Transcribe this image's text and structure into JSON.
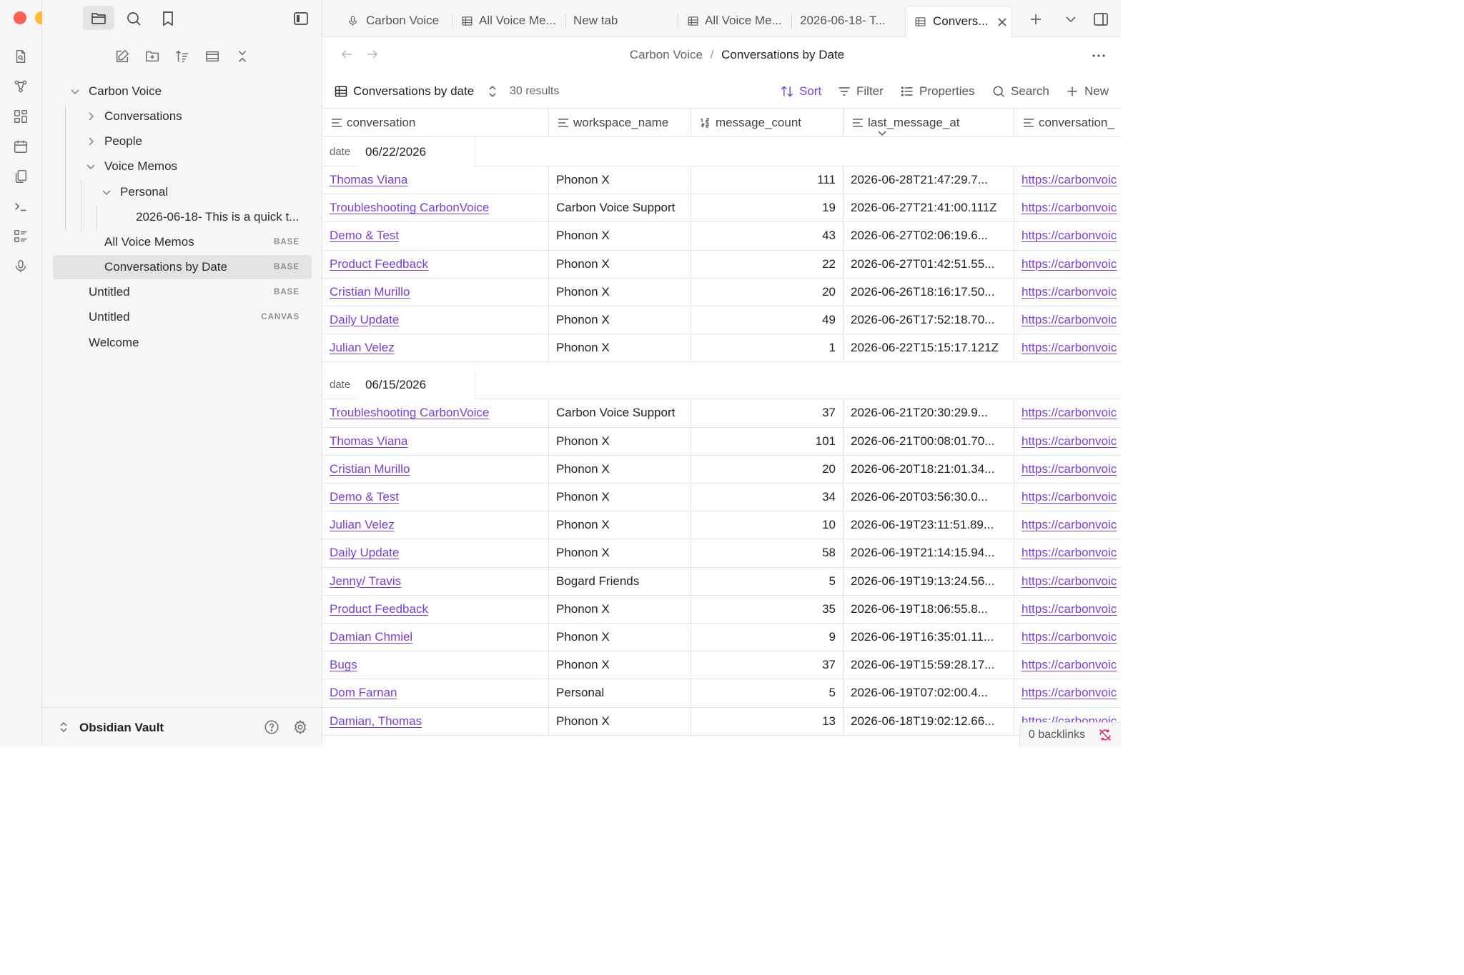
{
  "window": {
    "traffic_colors": [
      "#ff5f57",
      "#febc2e",
      "#28c840"
    ]
  },
  "ribbon": {
    "icons": [
      "quick-switcher-icon",
      "graph-view-icon",
      "canvas-icon",
      "daily-note-icon",
      "templates-icon",
      "command-palette-icon",
      "bases-icon",
      "voice-memo-icon"
    ]
  },
  "sidebar": {
    "tree": [
      {
        "label": "Carbon Voice",
        "level": 0,
        "chevron": "open",
        "badge": ""
      },
      {
        "label": "Conversations",
        "level": 1,
        "chevron": "closed",
        "badge": ""
      },
      {
        "label": "People",
        "level": 1,
        "chevron": "closed",
        "badge": ""
      },
      {
        "label": "Voice Memos",
        "level": 1,
        "chevron": "open",
        "badge": ""
      },
      {
        "label": "Personal",
        "level": 2,
        "chevron": "open",
        "badge": ""
      },
      {
        "label": "2026-06-18- This is a quick t...",
        "level": 3,
        "chevron": "",
        "badge": ""
      },
      {
        "label": "All Voice Memos",
        "level": 1,
        "chevron": "",
        "badge": "BASE"
      },
      {
        "label": "Conversations by Date",
        "level": 1,
        "chevron": "",
        "badge": "BASE",
        "selected": true
      },
      {
        "label": "Untitled",
        "level": 0,
        "chevron": "",
        "badge": "BASE"
      },
      {
        "label": "Untitled",
        "level": 0,
        "chevron": "",
        "badge": "CANVAS"
      },
      {
        "label": "Welcome",
        "level": 0,
        "chevron": "",
        "badge": ""
      }
    ],
    "vault_name": "Obsidian Vault"
  },
  "tabs": [
    {
      "label": "Carbon Voice",
      "icon": "microphone-icon"
    },
    {
      "label": "All Voice Me...",
      "icon": "table-icon"
    },
    {
      "label": "New tab",
      "icon": ""
    },
    {
      "label": "All Voice Me...",
      "icon": "table-icon"
    },
    {
      "label": "2026-06-18- T...",
      "icon": ""
    },
    {
      "label": "Convers...",
      "icon": "table-icon",
      "active": true
    }
  ],
  "breadcrumb": {
    "parent": "Carbon Voice",
    "separator": "/",
    "current": "Conversations by Date"
  },
  "toolbar": {
    "view_name": "Conversations by date",
    "results": "30 results",
    "sort": "Sort",
    "filter": "Filter",
    "properties": "Properties",
    "search": "Search",
    "new": "New",
    "accent": "#7b3fd6"
  },
  "table": {
    "columns": [
      {
        "label": "conversation",
        "icon": "text-icon"
      },
      {
        "label": "workspace_name",
        "icon": "text-icon"
      },
      {
        "label": "message_count",
        "icon": "number-icon"
      },
      {
        "label": "last_message_at",
        "icon": "text-icon",
        "sorted": true
      },
      {
        "label": "conversation_",
        "icon": "text-icon"
      }
    ],
    "groups": [
      {
        "label": "date",
        "value": "06/22/2026",
        "rows": [
          [
            "Thomas Viana",
            "Phonon X",
            "111",
            "2026-06-28T21:47:29.7...",
            "https://carbonvoic"
          ],
          [
            "Troubleshooting CarbonVoice",
            "Carbon Voice Support",
            "19",
            "2026-06-27T21:41:00.111Z",
            "https://carbonvoic"
          ],
          [
            "Demo & Test",
            "Phonon X",
            "43",
            "2026-06-27T02:06:19.6...",
            "https://carbonvoic"
          ],
          [
            "Product Feedback",
            "Phonon X",
            "22",
            "2026-06-27T01:42:51.55...",
            "https://carbonvoic"
          ],
          [
            "Cristian Murillo",
            "Phonon X",
            "20",
            "2026-06-26T18:16:17.50...",
            "https://carbonvoic"
          ],
          [
            "Daily Update",
            "Phonon X",
            "49",
            "2026-06-26T17:52:18.70...",
            "https://carbonvoic"
          ],
          [
            "Julian Velez",
            "Phonon X",
            "1",
            "2026-06-22T15:15:17.121Z",
            "https://carbonvoic"
          ]
        ]
      },
      {
        "label": "date",
        "value": "06/15/2026",
        "rows": [
          [
            "Troubleshooting CarbonVoice",
            "Carbon Voice Support",
            "37",
            "2026-06-21T20:30:29.9...",
            "https://carbonvoic"
          ],
          [
            "Thomas Viana",
            "Phonon X",
            "101",
            "2026-06-21T00:08:01.70...",
            "https://carbonvoic"
          ],
          [
            "Cristian Murillo",
            "Phonon X",
            "20",
            "2026-06-20T18:21:01.34...",
            "https://carbonvoic"
          ],
          [
            "Demo & Test",
            "Phonon X",
            "34",
            "2026-06-20T03:56:30.0...",
            "https://carbonvoic"
          ],
          [
            "Julian Velez",
            "Phonon X",
            "10",
            "2026-06-19T23:11:51.89...",
            "https://carbonvoic"
          ],
          [
            "Daily Update",
            "Phonon X",
            "58",
            "2026-06-19T21:14:15.94...",
            "https://carbonvoic"
          ],
          [
            "Jenny/ Travis",
            "Bogard Friends",
            "5",
            "2026-06-19T19:13:24.56...",
            "https://carbonvoic"
          ],
          [
            "Product Feedback",
            "Phonon X",
            "35",
            "2026-06-19T18:06:55.8...",
            "https://carbonvoic"
          ],
          [
            "Damian Chmiel",
            "Phonon X",
            "9",
            "2026-06-19T16:35:01.11...",
            "https://carbonvoic"
          ],
          [
            "Bugs",
            "Phonon X",
            "37",
            "2026-06-19T15:59:28.17...",
            "https://carbonvoic"
          ],
          [
            "Dom Farnan",
            "Personal",
            "5",
            "2026-06-19T07:02:00.4...",
            "https://carbonvoic"
          ],
          [
            "Damian, Thomas",
            "Phonon X",
            "13",
            "2026-06-18T19:02:12.66...",
            "https://carbonvoic"
          ]
        ]
      }
    ]
  },
  "status": {
    "backlinks": "0 backlinks"
  }
}
